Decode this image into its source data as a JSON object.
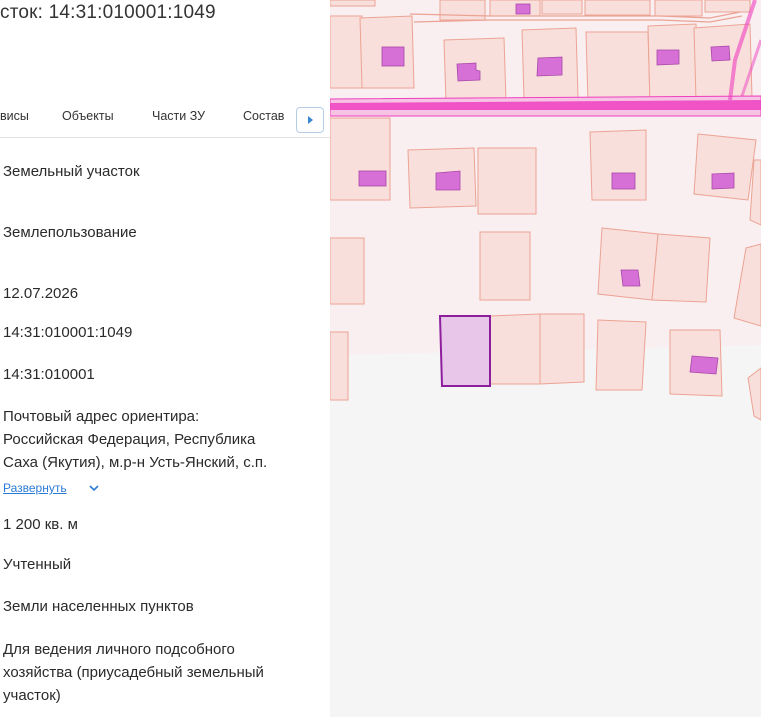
{
  "header": {
    "title": "сток: 14:31:010001:1049"
  },
  "tabs": [
    {
      "label": "висы"
    },
    {
      "label": "Объекты"
    },
    {
      "label": "Части ЗУ"
    },
    {
      "label": "Состав"
    }
  ],
  "info": {
    "object_type": "Земельный участок",
    "subtype": "Землепользование",
    "date": "12.07.2026",
    "cadastral_number": "14:31:010001:1049",
    "quarter": "14:31:010001",
    "address_lines": [
      "Почтовый адрес ориентира:",
      "Российская Федерация, Республика",
      "Саха (Якутия), м.р-н Усть-Янский, с.п."
    ],
    "expand_label": "Развернуть",
    "area": "1 200 кв. м",
    "status": "Учтенный",
    "category": "Земли населенных пунктов",
    "usage_lines": [
      "Для ведения личного подсобного",
      "хозяйства (приусадебный земельный",
      "участок)"
    ]
  },
  "colors": {
    "parcel_fill": "#f9dfdb",
    "parcel_stroke": "#eba394",
    "building": "#d670d6",
    "road": "#ee3fbf",
    "selected_fill": "#e8c6ea",
    "selected_stroke": "#8d1e9c",
    "link": "#2b7ad6"
  },
  "map": {
    "icons": [
      "map-parcels",
      "selected-parcel"
    ]
  }
}
